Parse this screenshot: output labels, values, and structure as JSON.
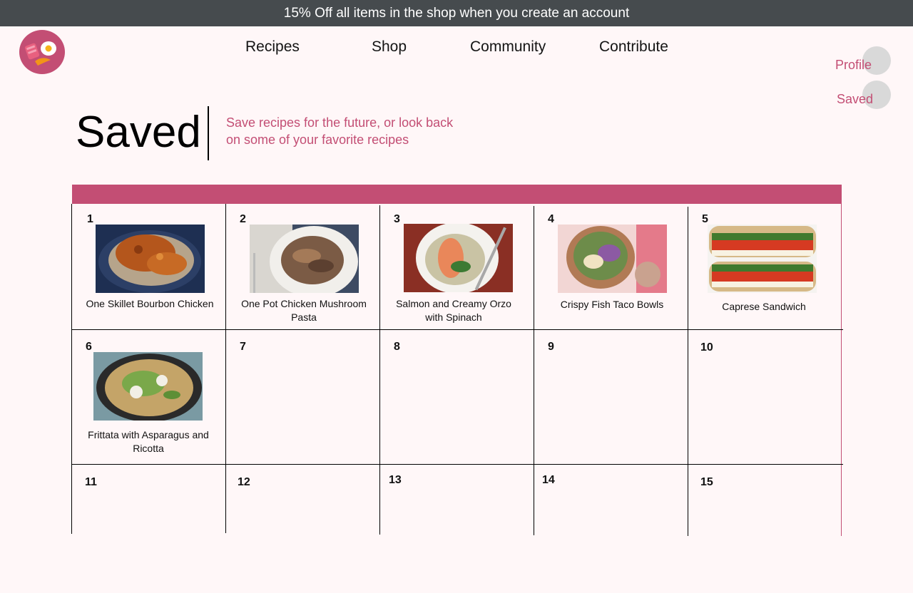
{
  "promo": {
    "text": "15% Off all items in the shop when you create an account"
  },
  "nav": {
    "recipes": "Recipes",
    "shop": "Shop",
    "community": "Community",
    "contribute": "Contribute"
  },
  "side": {
    "profile": "Profile",
    "saved": "Saved"
  },
  "header": {
    "title": "Saved",
    "subtitle": "Save recipes for the future, or look back on some of your favorite recipes"
  },
  "grid": {
    "cells": [
      {
        "num": "1",
        "title": "One Skillet Bourbon Chicken"
      },
      {
        "num": "2",
        "title": "One Pot Chicken Mushroom Pasta"
      },
      {
        "num": "3",
        "title": "Salmon and Creamy Orzo with Spinach"
      },
      {
        "num": "4",
        "title": "Crispy Fish Taco Bowls"
      },
      {
        "num": "5",
        "title": "Caprese Sandwich"
      },
      {
        "num": "6",
        "title": "Frittata with Asparagus and Ricotta"
      },
      {
        "num": "7"
      },
      {
        "num": "8"
      },
      {
        "num": "9"
      },
      {
        "num": "10"
      },
      {
        "num": "11"
      },
      {
        "num": "12"
      },
      {
        "num": "13"
      },
      {
        "num": "14"
      },
      {
        "num": "15"
      }
    ]
  },
  "colors": {
    "accent": "#c34e74",
    "promo_bg": "#464b4e",
    "page_bg": "#fff7f8"
  }
}
